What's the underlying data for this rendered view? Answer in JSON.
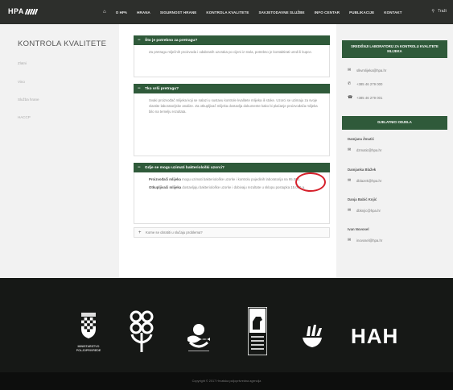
{
  "header": {
    "logo_text": "HPA",
    "nav_items": [
      "O HPA",
      "HRANA",
      "SIGURNOST HRANE",
      "KONTROLA KVALITETE",
      "SAVJETODAVNE SLUŽBE",
      "INFO CENTAR",
      "PUBLIKACIJE",
      "KONTAKT"
    ],
    "nav_right": "Traži"
  },
  "left": {
    "title": "KONTROLA KVALITETE",
    "links": [
      "Zlatni",
      "Vino",
      "Služba hrane",
      "HACCP"
    ]
  },
  "faq": [
    {
      "question": "Što je potrebno za pretragu?",
      "expanded": true,
      "answer": "Za pretragu mlječnih proizvoda i odabranih uzoraka po cijeni iz stola, potrebno je kontaktirati ured ili kupce."
    },
    {
      "question": "Tko vrši pretragu?",
      "expanded": true,
      "answer": "Svaki proizvođač mlijeka koji se nalazi u sustavu kontrole kvalitete mlijeka ili stoke. Uzorci se uzimaju za svoje vlastite laboratorijske analize. Za otkupljivač mlijeka dostavlja dokumente kako bi plaćanje proizvođača mlijeka bilo na temelju rezultata."
    },
    {
      "question": "Gdje se mogu uzimati bakteriološki uzorci?",
      "expanded": true,
      "answer_label_1": "Proizvođači mlijeka",
      "answer_text_1": "mogu uzimati bakteriološke uzorke i kontrolu pojedinih laboratorija na 95.000.",
      "answer_label_2": "Otkupljivači mlijeka",
      "answer_text_2": "dostavljaju bakteriološke uzorke i dobivaju rezultate u sklopu postupka 15.000 a."
    },
    {
      "question": "Kome se obratiti u slučaju problema?",
      "expanded": false
    }
  ],
  "right": {
    "lab_title": "SREDIŠNJI LABORATORIJ ZA KONTROLU KVALITETE MLIJEKA",
    "lab_email": "slkvmlijeka@hpa.hr",
    "lab_phone": "+385 46 279 000",
    "lab_fax": "+385 46 279 001",
    "staff_title": "DJELATNICI ODJELA",
    "staff": [
      {
        "name": "Damjana Žmatić",
        "email": "dzmatic@hpa.hr"
      },
      {
        "name": "Damjanka Blažek",
        "email": "dblazek@hpa.hr"
      },
      {
        "name": "Danja Babić Knjić",
        "email": "dbknjic@hpa.hr"
      },
      {
        "name": "Ivan Novosel",
        "email": "inovosel@hpa.hr"
      }
    ]
  },
  "footer": {
    "logo_labels": [
      "MINISTARSTVO POLJOPRIVREDE",
      "",
      "",
      "",
      "",
      "HAH"
    ],
    "copyright": "Copyright © 2017 Hrvatska poljoprivredna agencija"
  },
  "colors": {
    "accent": "#2f5a3a",
    "topbar": "#2d2f2c",
    "footer": "#161816",
    "highlight": "#d6202b"
  }
}
